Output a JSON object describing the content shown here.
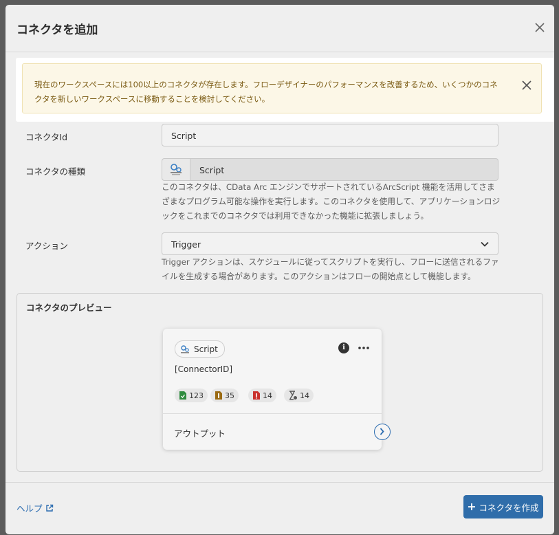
{
  "modal": {
    "title": "コネクタを追加"
  },
  "warning": {
    "message": "現在のワークスペースには100以上のコネクタが存在します。フローデザイナーのパフォーマンスを改善するため、いくつかのコネクタを新しいワークスペースに移動することを検討してください。"
  },
  "form": {
    "connector_id": {
      "label": "コネクタId",
      "value": "Script"
    },
    "connector_type": {
      "label": "コネクタの種類",
      "value": "Script",
      "icon": "script-connector-icon",
      "description": "このコネクタは、CData Arc エンジンでサポートされているArcScript 機能を活用してさまざまなプログラム可能な操作を実行します。このコネクタを使用して、アプリケーションロジックをこれまでのコネクタでは利用できなかった機能に拡張しましょう。"
    },
    "action": {
      "label": "アクション",
      "value": "Trigger",
      "description": "Trigger アクションは、スケジュールに従ってスクリプトを実行し、フローに送信されるファイルを生成する場合があります。このアクションはフローの開始点として機能します。"
    }
  },
  "preview": {
    "title": "コネクタのプレビュー",
    "card": {
      "type_label": "Script",
      "name": "[ConnectorID]",
      "stats": [
        {
          "icon": "file-success-icon",
          "value": "123",
          "color": "#2e8b3e"
        },
        {
          "icon": "file-queued-icon",
          "value": "35",
          "color": "#9a6a12"
        },
        {
          "icon": "file-error-icon",
          "value": "14",
          "color": "#c9302c"
        },
        {
          "icon": "hourglass-icon",
          "value": "14",
          "color": "#555555"
        }
      ],
      "output_label": "アウトプット"
    }
  },
  "footer": {
    "help_label": "ヘルプ",
    "create_label": "コネクタを作成"
  }
}
